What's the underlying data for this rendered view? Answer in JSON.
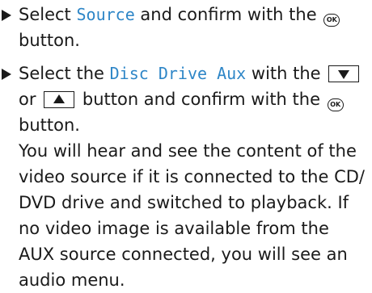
{
  "step1": {
    "prefix": "Select",
    "keyword": "Source",
    "mid": "and confirm with the",
    "ok_icon": "OK",
    "suffix": "button."
  },
  "step2": {
    "prefix": "Select the",
    "keyword": "Disc Drive Aux",
    "with_the": "with the",
    "or": "or",
    "confirm": "button and confirm with the",
    "ok_icon": "OK",
    "suffix": "button.",
    "paragraph": "You will hear and see the content of the video source if it is connected to the CD/ DVD drive and switched to playback. If no video image is available from the AUX source connected, you will see an audio menu."
  },
  "icons": {
    "bullet": "triangle-right-icon",
    "down_button": "arrow-down-icon",
    "up_button": "arrow-up-icon",
    "ok_button": "ok-button-icon"
  },
  "colors": {
    "highlight": "#2e86c7",
    "text": "#1a1a1a"
  }
}
